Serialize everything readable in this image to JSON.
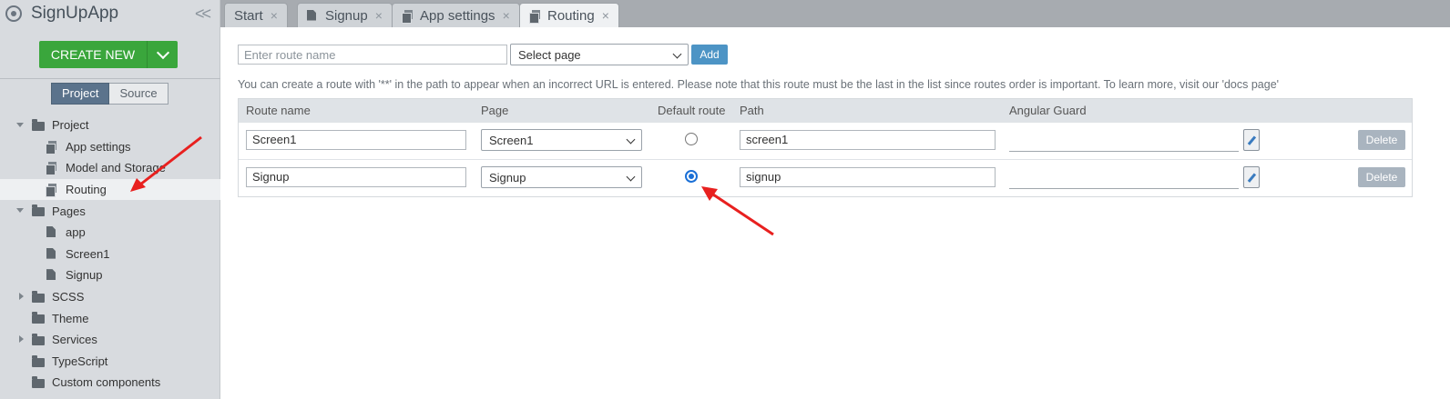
{
  "app": {
    "title": "SignUpApp"
  },
  "sidebar": {
    "create_new_label": "CREATE NEW",
    "segment": {
      "project": "Project",
      "source": "Source"
    },
    "tree": [
      {
        "label": "Project",
        "icon": "folder-icon",
        "level": 0,
        "expander": "expanded"
      },
      {
        "label": "App settings",
        "icon": "settings-file-icon",
        "level": 1
      },
      {
        "label": "Model and Storage",
        "icon": "settings-file-icon",
        "level": 1
      },
      {
        "label": "Routing",
        "icon": "settings-file-icon",
        "level": 1,
        "selected": true
      },
      {
        "label": "Pages",
        "icon": "folder-icon",
        "level": 0,
        "expander": "expanded"
      },
      {
        "label": "app",
        "icon": "file-icon",
        "level": 1
      },
      {
        "label": "Screen1",
        "icon": "file-icon",
        "level": 1
      },
      {
        "label": "Signup",
        "icon": "file-icon",
        "level": 1
      },
      {
        "label": "SCSS",
        "icon": "folder-icon",
        "level": 0,
        "expander": "collapsed"
      },
      {
        "label": "Theme",
        "icon": "folder-icon",
        "level": 0
      },
      {
        "label": "Services",
        "icon": "folder-icon",
        "level": 0,
        "expander": "collapsed"
      },
      {
        "label": "TypeScript",
        "icon": "folder-icon",
        "level": 0
      },
      {
        "label": "Custom components",
        "icon": "folder-icon",
        "level": 0
      }
    ]
  },
  "tabs": [
    {
      "label": "Start",
      "icon": "",
      "active": false
    },
    {
      "label": "Signup",
      "icon": "file-icon",
      "active": false
    },
    {
      "label": "App settings",
      "icon": "settings-file-icon",
      "active": false
    },
    {
      "label": "Routing",
      "icon": "settings-file-icon",
      "active": true
    }
  ],
  "tab_close_glyph": "×",
  "routing": {
    "route_name_placeholder": "Enter route name",
    "select_page_value": "Select page",
    "add_label": "Add",
    "info_text": "You can create a route with '**' in the path to appear when an incorrect URL is entered. Please note that this route must be the last in the list since routes order is important. To learn more, visit our 'docs page'",
    "columns": [
      "Route name",
      "Page",
      "Default route",
      "Path",
      "Angular Guard"
    ],
    "rows": [
      {
        "route_name": "Screen1",
        "page": "Screen1",
        "default": false,
        "path": "screen1",
        "guard": "",
        "delete_label": "Delete"
      },
      {
        "route_name": "Signup",
        "page": "Signup",
        "default": true,
        "path": "signup",
        "guard": "",
        "delete_label": "Delete"
      }
    ]
  },
  "colors": {
    "create_new": "#3aa63c",
    "add_button": "#4d94c5",
    "radio_checked": "#1a6fd6",
    "annotation_arrow": "#e8201f"
  }
}
